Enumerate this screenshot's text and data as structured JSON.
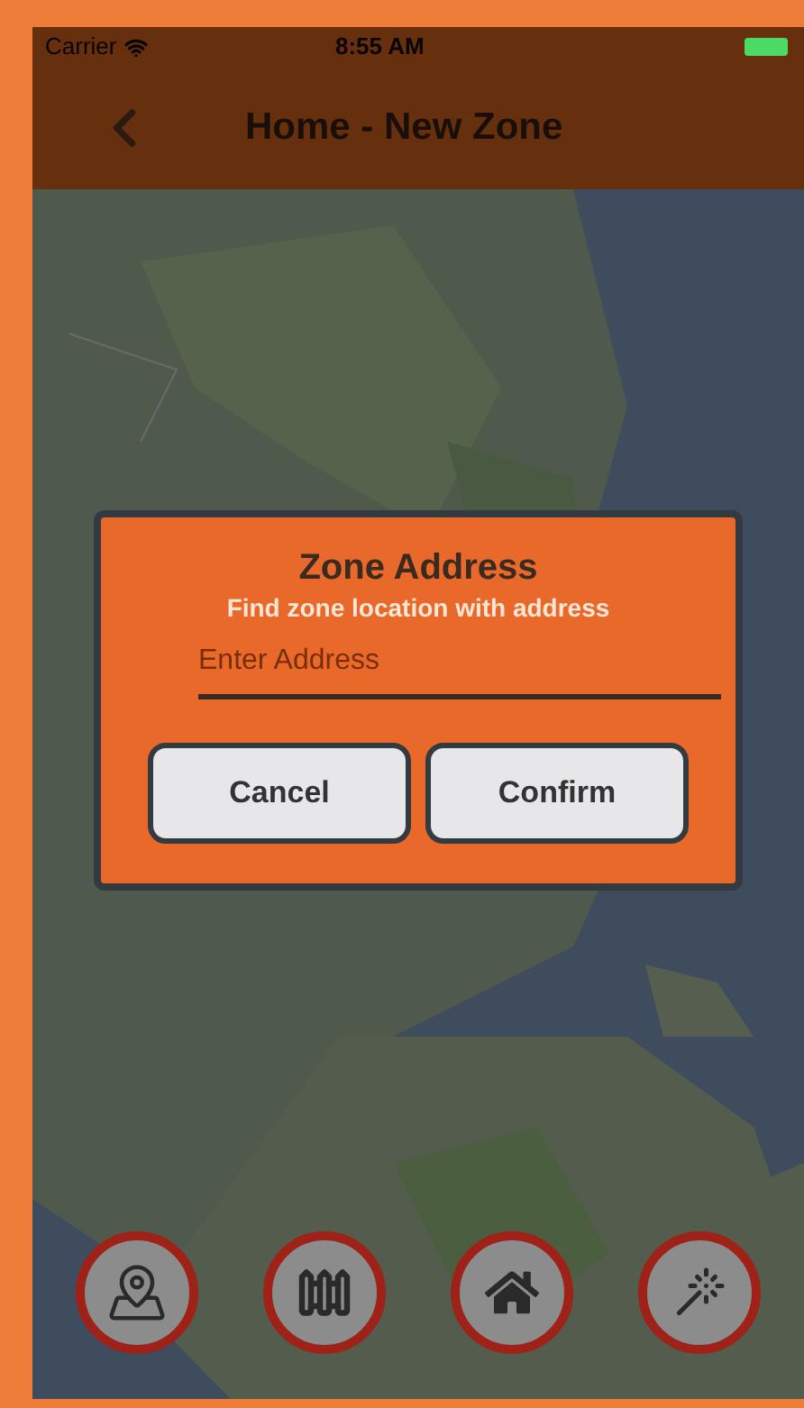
{
  "status_bar": {
    "carrier": "Carrier",
    "time": "8:55 AM"
  },
  "nav_bar": {
    "title": "Home - New Zone"
  },
  "dialog": {
    "title": "Zone Address",
    "subtitle": "Find zone location with address",
    "address_field": {
      "placeholder": "Enter Address"
    },
    "buttons": [
      "Cancel",
      "Confirm"
    ]
  },
  "toolbar": [
    {
      "kind": "map"
    },
    {
      "kind": "fence"
    },
    {
      "kind": "home"
    },
    {
      "kind": "wand"
    }
  ]
}
